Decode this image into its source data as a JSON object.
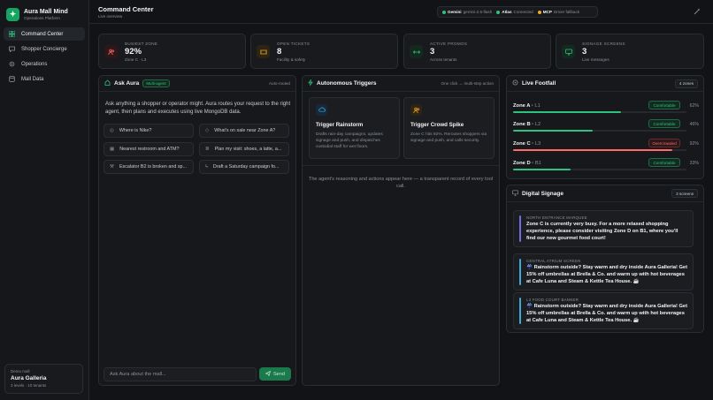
{
  "brand": {
    "name": "Aura Mall Mind",
    "subtitle": "Operations Platform"
  },
  "nav": [
    {
      "label": "Command Center",
      "icon": "grid-icon",
      "active": true
    },
    {
      "label": "Shopper Concierge",
      "icon": "chat-icon"
    },
    {
      "label": "Operations",
      "icon": "gear-icon"
    },
    {
      "label": "Mall Data",
      "icon": "database-icon"
    }
  ],
  "demo": {
    "label": "Demo mall",
    "name": "Aura Galleria",
    "meta": "3 levels · 10 tenants"
  },
  "header": {
    "title": "Command Center",
    "subtitle": "Live overview"
  },
  "status": [
    {
      "name": "Gemini",
      "detail": "gemini-2.5-flash",
      "color": "#2ec27e"
    },
    {
      "name": "Atlas",
      "detail": "Connected",
      "color": "#2ec27e"
    },
    {
      "name": "MCP",
      "detail": "Driver fallback",
      "color": "#f0a830"
    }
  ],
  "kpis": [
    {
      "label": "BUSIEST ZONE",
      "value": "92%",
      "sub": "Zone C · L3",
      "icon": "people-icon",
      "color": "#ff6b6b"
    },
    {
      "label": "OPEN TICKETS",
      "value": "8",
      "sub": "Facility & safety",
      "icon": "ticket-icon",
      "color": "#f0a830"
    },
    {
      "label": "ACTIVE PROMOS",
      "value": "3",
      "sub": "Across tenants",
      "icon": "arrows-icon",
      "color": "#2ec27e"
    },
    {
      "label": "SIGNAGE SCREENS",
      "value": "3",
      "sub": "Live messages",
      "icon": "monitor-icon",
      "color": "#2ec27e"
    }
  ],
  "ask": {
    "title": "Ask Aura",
    "badge": "Multi-agent",
    "right": "Auto-routed",
    "intro": "Ask anything a shopper or operator might. Aura routes your request to the right agent, then plans and executes using live MongoDB data.",
    "suggestions": [
      {
        "text": "Where is Nike?",
        "icon": "pin-icon"
      },
      {
        "text": "What's on sale near Zone A?",
        "icon": "tag-icon"
      },
      {
        "text": "Nearest restroom and ATM?",
        "icon": "grid-icon"
      },
      {
        "text": "Plan my visit: shoes, a latte, a...",
        "icon": "list-icon"
      },
      {
        "text": "Escalator B2 is broken and sp...",
        "icon": "wrench-icon"
      },
      {
        "text": "Draft a Saturday campaign fo...",
        "icon": "bolt-icon"
      }
    ],
    "placeholder": "Ask Aura about the mall...",
    "send": "Send"
  },
  "triggers": {
    "title": "Autonomous Triggers",
    "right": "One click → multi-step action",
    "items": [
      {
        "title": "Trigger Rainstorm",
        "desc": "Drafts rain-day campaigns, updates signage and push, and dispatches custodial staff for wet floors.",
        "icon": "cloud-icon",
        "color": "#3fa9d6"
      },
      {
        "title": "Trigger Crowd Spike",
        "desc": "Zone C hits 92%. Reroutes shoppers via signage and push, and calls security.",
        "icon": "people-icon",
        "color": "#f0a830"
      }
    ],
    "reasoning": "The agent's reasoning and actions appear here — a transparent record of every tool call."
  },
  "footfall": {
    "title": "Live Footfall",
    "count": "4 zones",
    "zones": [
      {
        "name": "Zone A",
        "level": "L1",
        "status": "Comfortable",
        "pct": 62,
        "pct_label": "62%",
        "ok": true
      },
      {
        "name": "Zone B",
        "level": "L2",
        "status": "Comfortable",
        "pct": 46,
        "pct_label": "46%",
        "ok": true
      },
      {
        "name": "Zone C",
        "level": "L3",
        "status": "Overcrowded",
        "pct": 92,
        "pct_label": "92%",
        "ok": false
      },
      {
        "name": "Zone D",
        "level": "B1",
        "status": "Comfortable",
        "pct": 33,
        "pct_label": "33%",
        "ok": true
      }
    ]
  },
  "signage": {
    "title": "Digital Signage",
    "count": "3 screens",
    "screens": [
      {
        "label": "NORTH ENTRANCE MARQUEE",
        "text": "Zone C is currently very busy. For a more relaxed shopping experience, please consider visiting Zone D on B1, where you'll find our new gourmet food court!",
        "color": "#6e6ee0"
      },
      {
        "label": "CENTRAL ATRIUM SCREEN",
        "text": "☔ Rainstorm outside? Stay warm and dry inside Aura Galleria! Get 15% off umbrellas at Brella & Co. and warm up with hot beverages at Cafe Luna and Steam & Kettle Tea House. ☕",
        "color": "#3fa9d6"
      },
      {
        "label": "L3 FOOD COURT BANNER",
        "text": "☔ Rainstorm outside? Stay warm and dry inside Aura Galleria! Get 15% off umbrellas at Brella & Co. and warm up with hot beverages at Cafe Luna and Steam & Kettle Tea House. ☕",
        "color": "#3fa9d6"
      }
    ]
  }
}
